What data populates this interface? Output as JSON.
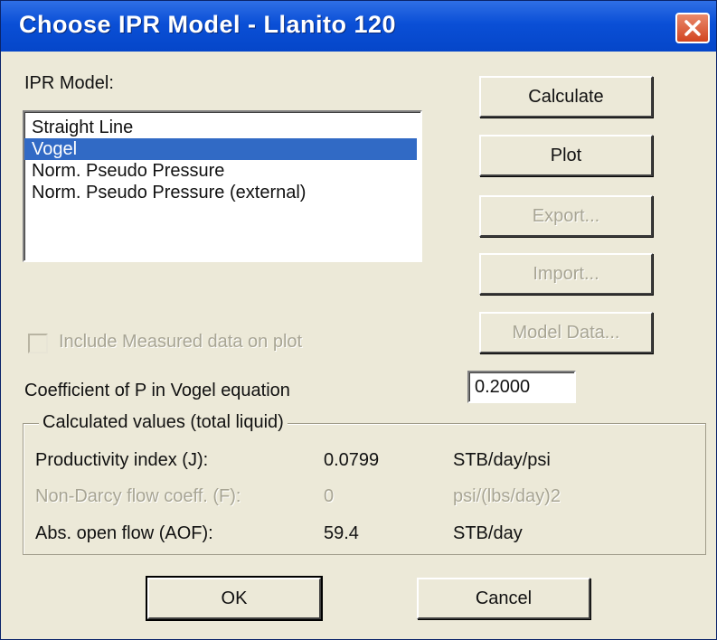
{
  "window": {
    "title": "Choose IPR Model - Llanito 120"
  },
  "ipr_model": {
    "label": "IPR Model:",
    "items": [
      {
        "label": "Straight Line",
        "selected": false
      },
      {
        "label": "Vogel",
        "selected": true
      },
      {
        "label": "Norm. Pseudo Pressure",
        "selected": false
      },
      {
        "label": "Norm. Pseudo Pressure (external)",
        "selected": false
      }
    ]
  },
  "actions": {
    "calculate": "Calculate",
    "plot": "Plot",
    "export": "Export...",
    "import": "Import...",
    "model_data": "Model Data..."
  },
  "include_measured": {
    "label": "Include Measured data on plot",
    "checked": false,
    "enabled": false
  },
  "coefficient": {
    "label": "Coefficient of P in Vogel equation",
    "value": "0.2000"
  },
  "calculated": {
    "title": "Calculated values (total liquid)",
    "rows": [
      {
        "label": "Productivity index (J):",
        "value": "0.0799",
        "unit": "STB/day/psi",
        "enabled": true
      },
      {
        "label": "Non-Darcy flow coeff. (F):",
        "value": "0",
        "unit": "psi/(lbs/day)2",
        "enabled": false
      },
      {
        "label": "Abs. open flow (AOF):",
        "value": "59.4",
        "unit": "STB/day",
        "enabled": true
      }
    ]
  },
  "dialog_buttons": {
    "ok": "OK",
    "cancel": "Cancel"
  }
}
